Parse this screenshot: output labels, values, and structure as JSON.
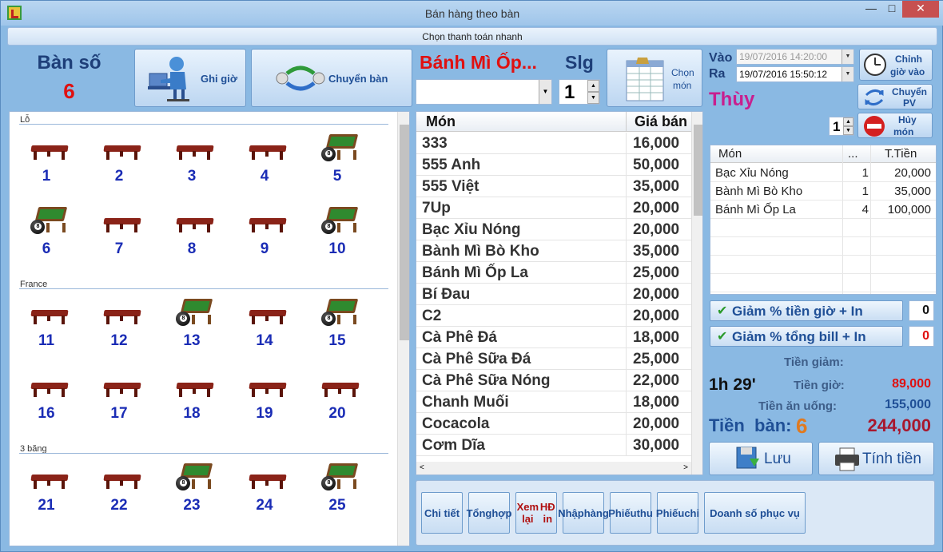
{
  "window": {
    "title": "Bán hàng theo bàn",
    "minimize": "—",
    "maximize": "□",
    "close": "✕"
  },
  "quickpay": "Chọn thanh toán nhanh",
  "table_info": {
    "label": "Bàn số",
    "number": "6"
  },
  "buttons": {
    "ghi_gio": "Ghi giờ",
    "chuyen_ban": "Chuyển bàn",
    "chon_mon_1": "Chọn",
    "chon_mon_2": "món",
    "chinh_gio_1": "Chỉnh",
    "chinh_gio_2": "giờ vào",
    "chuyen_pv_1": "Chuyển",
    "chuyen_pv_2": "PV",
    "huy_mon_1": "Hủy",
    "huy_mon_2": "món",
    "luu": "Lưu",
    "tinh_tien": "Tính tiền"
  },
  "groups": [
    {
      "title": "Lỗ",
      "tables": [
        {
          "n": "1",
          "busy": false
        },
        {
          "n": "2",
          "busy": false
        },
        {
          "n": "3",
          "busy": false
        },
        {
          "n": "4",
          "busy": false
        },
        {
          "n": "5",
          "busy": true
        },
        {
          "n": "6",
          "busy": true
        },
        {
          "n": "7",
          "busy": false
        },
        {
          "n": "8",
          "busy": false
        },
        {
          "n": "9",
          "busy": false
        },
        {
          "n": "10",
          "busy": true
        }
      ]
    },
    {
      "title": "France",
      "tables": [
        {
          "n": "11",
          "busy": false
        },
        {
          "n": "12",
          "busy": false
        },
        {
          "n": "13",
          "busy": true
        },
        {
          "n": "14",
          "busy": false
        },
        {
          "n": "15",
          "busy": true
        },
        {
          "n": "16",
          "busy": false
        },
        {
          "n": "17",
          "busy": false
        },
        {
          "n": "18",
          "busy": false
        },
        {
          "n": "19",
          "busy": false
        },
        {
          "n": "20",
          "busy": false
        }
      ]
    },
    {
      "title": "3 băng",
      "tables": [
        {
          "n": "21",
          "busy": false
        },
        {
          "n": "22",
          "busy": false
        },
        {
          "n": "23",
          "busy": true
        },
        {
          "n": "24",
          "busy": false
        },
        {
          "n": "25",
          "busy": true
        }
      ]
    }
  ],
  "food": {
    "selected": "Bánh Mì Ốp...",
    "slg_label": "Slg",
    "qty": "1"
  },
  "menu": {
    "col_name": "Món",
    "col_price": "Giá bán",
    "items": [
      {
        "name": "333",
        "price": "16,000"
      },
      {
        "name": "555 Anh",
        "price": "50,000"
      },
      {
        "name": "555 Việt",
        "price": "35,000"
      },
      {
        "name": "7Up",
        "price": "20,000"
      },
      {
        "name": "Bạc Xỉu Nóng",
        "price": "20,000"
      },
      {
        "name": "Bành Mì Bò Kho",
        "price": "35,000"
      },
      {
        "name": "Bánh Mì Ốp La",
        "price": "25,000"
      },
      {
        "name": "Bí Đau",
        "price": "20,000"
      },
      {
        "name": "C2",
        "price": "20,000"
      },
      {
        "name": "Cà Phê Đá",
        "price": "18,000"
      },
      {
        "name": "Cà Phê Sữa Đá",
        "price": "25,000"
      },
      {
        "name": "Cà Phê Sữa Nóng",
        "price": "22,000"
      },
      {
        "name": "Chanh Muối",
        "price": "18,000"
      },
      {
        "name": "Cocacola",
        "price": "20,000"
      },
      {
        "name": "Cơm Dĩa",
        "price": "30,000"
      }
    ]
  },
  "time": {
    "vao_label": "Vào",
    "ra_label": "Ra",
    "vao": "19/07/2016 14:20:00",
    "ra": "19/07/2016 15:50:12"
  },
  "staff": "Thùy",
  "cancel_qty": "1",
  "order": {
    "col_name": "Món",
    "col_qty": "...",
    "col_total": "T.Tiền",
    "items": [
      {
        "name": "Bạc Xỉu Nóng",
        "qty": "1",
        "total": "20,000"
      },
      {
        "name": "Bành Mì Bò Kho",
        "qty": "1",
        "total": "35,000"
      },
      {
        "name": "Bánh Mì Ốp La",
        "qty": "4",
        "total": "100,000"
      }
    ]
  },
  "discounts": [
    {
      "label": "Giảm % tiền giờ + In",
      "value": "0",
      "color": "#111111"
    },
    {
      "label": "Giảm % tổng bill + In",
      "value": "0",
      "color": "#e01010"
    }
  ],
  "summary": {
    "tien_giam_label": "Tiền giảm:",
    "duration": "1h 29'",
    "tien_gio_label": "Tiền giờ:",
    "tien_gio": "89,000",
    "tien_an_uong_label": "Tiền ăn uống:",
    "tien_an_uong": "155,000",
    "tien_ban_label": "Tiền  bàn:",
    "tien_ban_num": "6",
    "total": "244,000"
  },
  "bottom_buttons": [
    {
      "l1": "Chi tiết",
      "l2": "",
      "color": "#1f4f96"
    },
    {
      "l1": "Tổng",
      "l2": "hợp",
      "color": "#1f4f96"
    },
    {
      "l1": "Xem lại",
      "l2": "HĐ in",
      "color": "#b01010"
    },
    {
      "l1": "Nhập",
      "l2": "hàng",
      "color": "#1f4f96"
    },
    {
      "l1": "Phiếu",
      "l2": "thu",
      "color": "#1f4f96"
    },
    {
      "l1": "Phiếu",
      "l2": "chi",
      "color": "#1f4f96"
    },
    {
      "l1": "Doanh số phục vụ",
      "l2": "",
      "color": "#1f4f96"
    }
  ]
}
